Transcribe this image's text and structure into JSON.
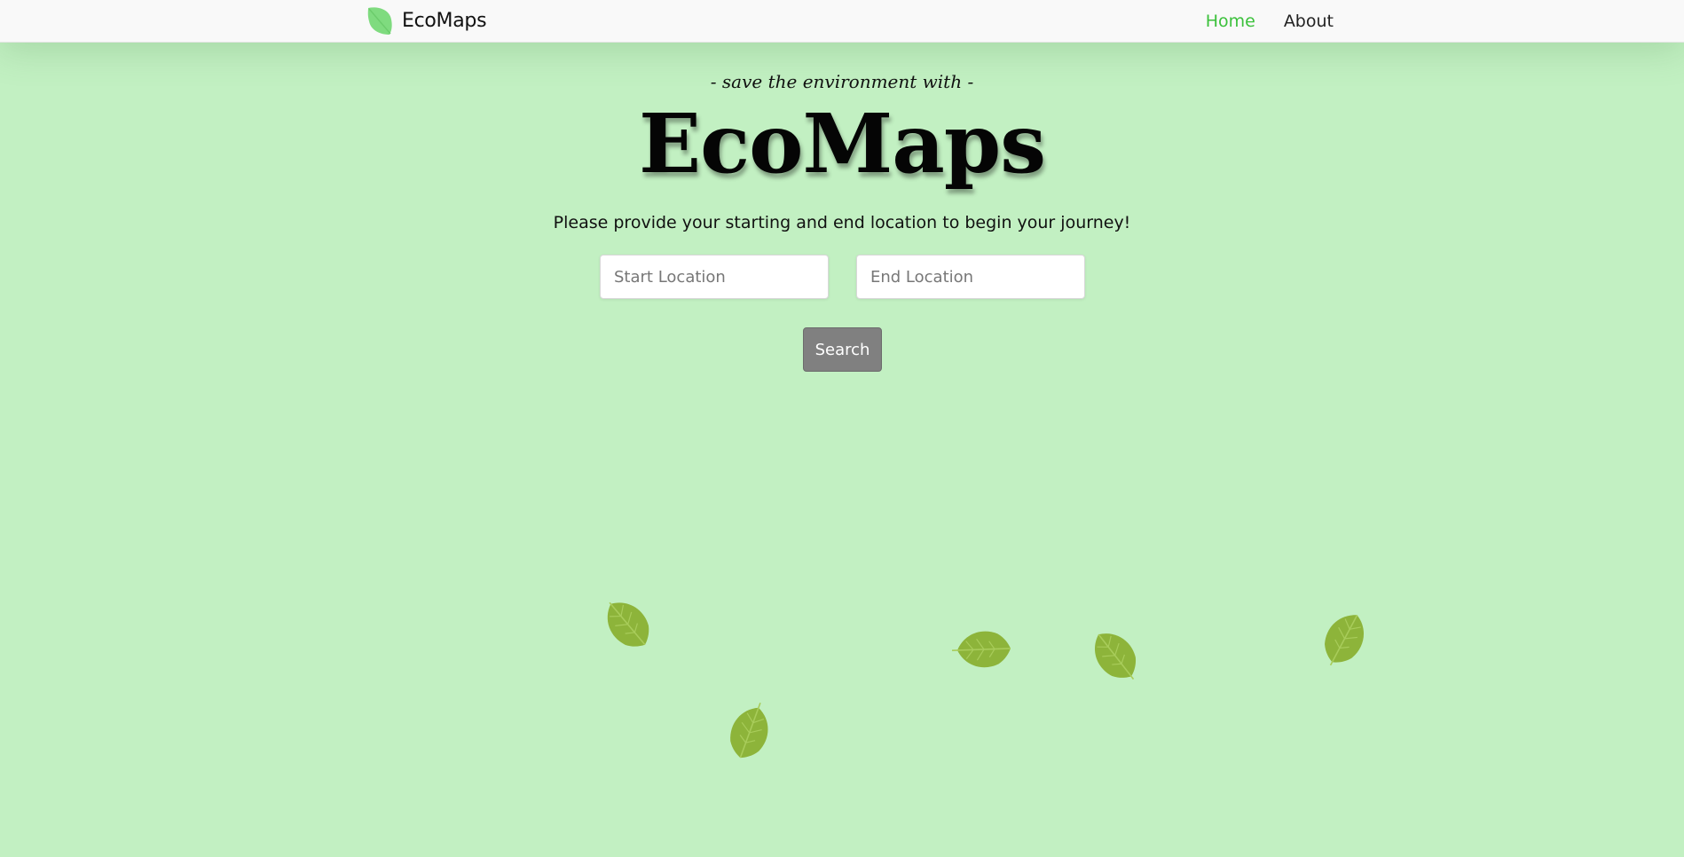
{
  "navbar": {
    "brand_name": "EcoMaps",
    "brand_icon": "leaf-icon",
    "links": [
      {
        "label": "Home",
        "active": true
      },
      {
        "label": "About",
        "active": false
      }
    ]
  },
  "hero": {
    "tagline": "- save the environment with -",
    "title": "EcoMaps",
    "instructions": "Please provide your starting and end location to begin your journey!"
  },
  "form": {
    "start": {
      "placeholder": "Start Location",
      "value": ""
    },
    "end": {
      "placeholder": "End Location",
      "value": ""
    },
    "search_label": "Search"
  },
  "decorations": {
    "icon": "leaf-icon",
    "count": 6
  },
  "colors": {
    "background": "#c2f0c2",
    "navbar": "#f9f9f9",
    "accent": "#3cc13c",
    "logo_leaf": "#7fdb7f",
    "leaf": "#8db43a",
    "leaf_vein": "#a8cc5a",
    "button": "#808080"
  }
}
